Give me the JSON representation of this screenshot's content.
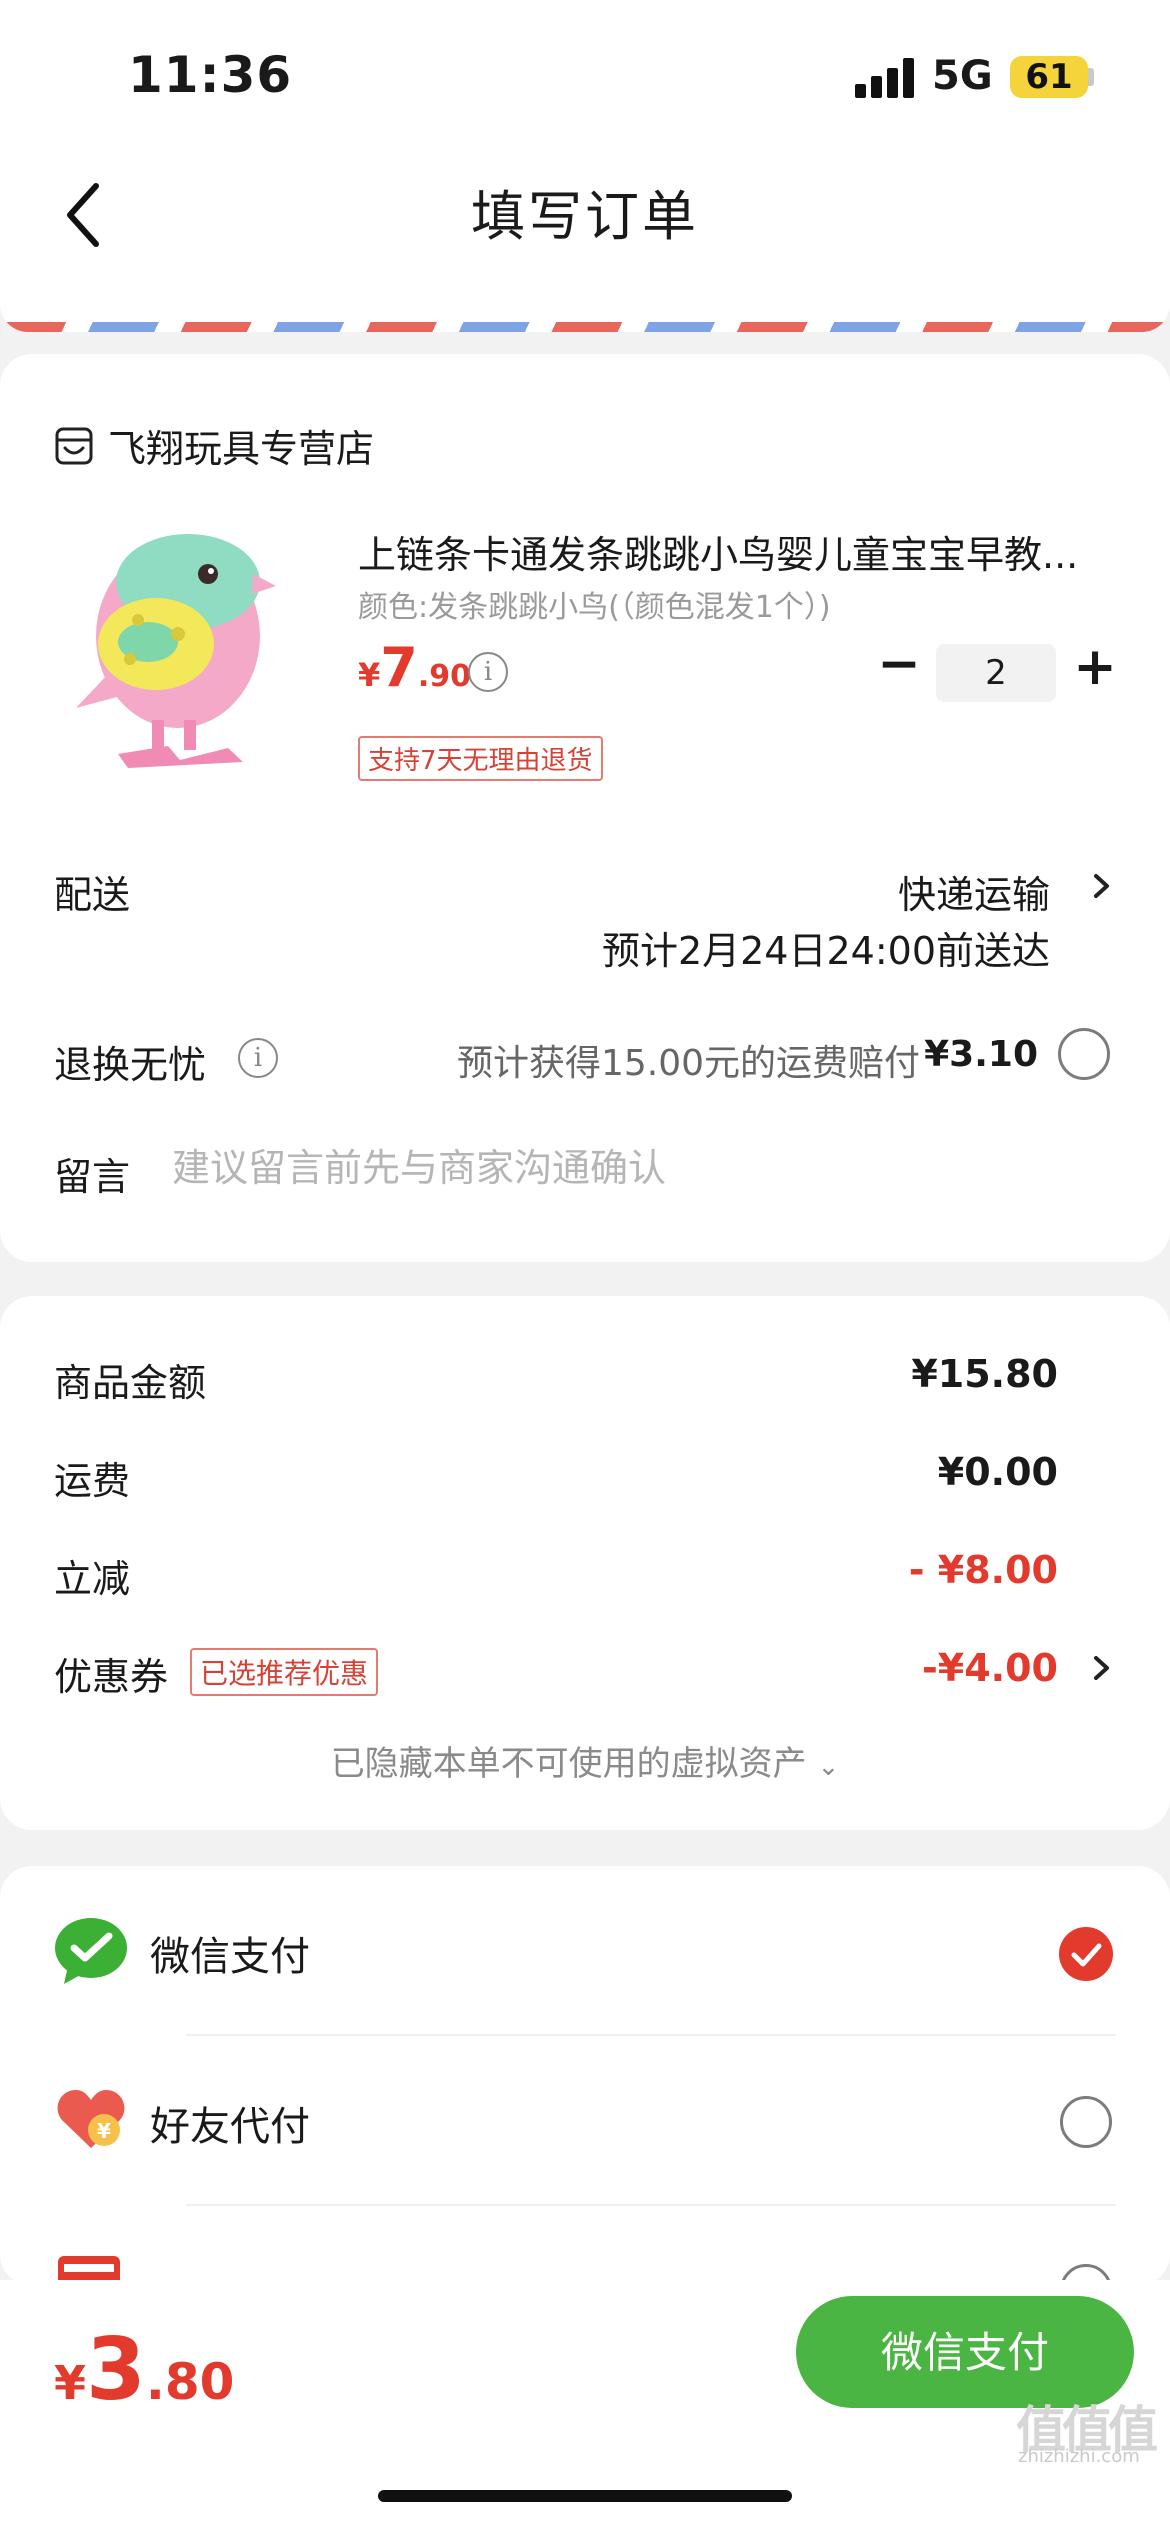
{
  "status_bar": {
    "time": "11:36",
    "network": "5G",
    "battery": "61"
  },
  "nav": {
    "title": "填写订单"
  },
  "shop": {
    "name": "飞翔玩具专营店"
  },
  "product": {
    "title": "上链条卡通发条跳跳小鸟婴儿童宝宝早教...",
    "spec": "颜色:发条跳跳小鸟(（颜色混发1个）)",
    "price_currency": "¥",
    "price_int": "7",
    "price_dec": ".90",
    "quantity": "2",
    "return_policy": "支持7天无理由退货"
  },
  "delivery": {
    "label": "配送",
    "method": "快递运输",
    "eta": "预计2月24日24:00前送达"
  },
  "insurance": {
    "label": "退换无忧",
    "desc": "预计获得15.00元的运费赔付",
    "price": "¥3.10"
  },
  "message": {
    "label": "留言",
    "placeholder": "建议留言前先与商家沟通确认"
  },
  "summary": {
    "goods_label": "商品金额",
    "goods_value": "¥15.80",
    "shipping_label": "运费",
    "shipping_value": "¥0.00",
    "discount_label": "立减",
    "discount_value": "- ¥8.00",
    "coupon_label": "优惠券",
    "coupon_tag": "已选推荐优惠",
    "coupon_value": "-¥4.00",
    "hidden_assets": "已隐藏本单不可使用的虚拟资产"
  },
  "payment": {
    "options": [
      {
        "label": "微信支付",
        "selected": true
      },
      {
        "label": "好友代付",
        "selected": false
      },
      {
        "label": "",
        "selected": false
      }
    ]
  },
  "bottom": {
    "total_currency": "¥",
    "total_int": "3",
    "total_dec": ".80",
    "pay_button": "微信支付"
  },
  "watermark": {
    "glyphs": "值值值",
    "domain": "zhizhizhi.com"
  },
  "colors": {
    "accent_red": "#e23b2e",
    "wechat_green": "#4bb543"
  }
}
